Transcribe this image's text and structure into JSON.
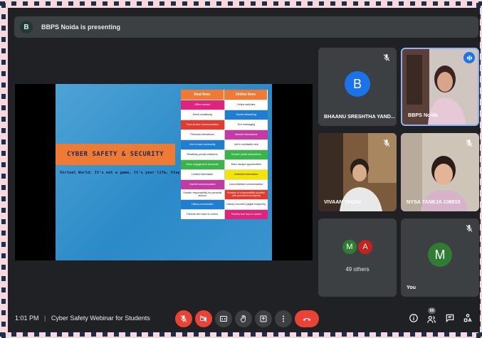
{
  "banner": {
    "avatar_letter": "B",
    "text": "BBPS Noida is presenting"
  },
  "slide": {
    "title": "CYBER SAFETY & SECURITY",
    "subtitle": "Virtual World: It's not a game, It's your life, Stay Safe !",
    "table": {
      "headers": [
        "Real lives",
        "Online lives"
      ],
      "rows": [
        {
          "left": "Office contact",
          "right": "Online activities",
          "lc": "#e0247d",
          "rc": "#ffffff"
        },
        {
          "left": "Direct socialising",
          "right": "Social networking",
          "lc": "#ffffff",
          "rc": "#1e7fd1"
        },
        {
          "left": "Face-to-face communication",
          "right": "Text messaging",
          "lc": "#e23a2e",
          "rc": "#ffffff"
        },
        {
          "left": "Personal interactions",
          "right": "Internet interactions",
          "lc": "#ffffff",
          "rc": "#c33aa4"
        },
        {
          "left": "Life in local community",
          "right": "Life in worldwide web",
          "lc": "#1e7fd1",
          "rc": "#ffffff"
        },
        {
          "left": "Relatively private existence",
          "right": "Greater public interactions",
          "lc": "#ffffff",
          "rc": "#39b54a"
        },
        {
          "left": "More engagement demands",
          "right": "More escape opportunities",
          "lc": "#39b54a",
          "rc": "#ffffff"
        },
        {
          "left": "Limited information",
          "right": "Unlimited information",
          "lc": "#ffffff",
          "rc": "#f2e500"
        },
        {
          "left": "Careful communication",
          "right": "Less inhibited communication",
          "lc": "#c33aa4",
          "rc": "#ffffff"
        },
        {
          "left": "Greater responsibility for personal actions",
          "right": "Evasion of responsibility possible with perceived anonymity",
          "lc": "#ffffff",
          "rc": "#e23a2e"
        },
        {
          "left": "History unrecorded",
          "right": "History recorded (digital footprints)",
          "lc": "#1e7fd1",
          "rc": "#ffffff"
        },
        {
          "left": "Parents feel more in control",
          "right": "Parents feel less in control",
          "lc": "#ffffff",
          "rc": "#e0247d"
        }
      ]
    }
  },
  "participants": {
    "bhaanu": {
      "letter": "B",
      "name": "BHAANU SRESHTHA YAND...",
      "color": "#1a73e8"
    },
    "bbps": {
      "name": "BBPS Noida"
    },
    "vivaan": {
      "name": "VIVAAN YADAV"
    },
    "nysa": {
      "name": "NYSA TANEJA 108815"
    },
    "others": {
      "letters": [
        "M",
        "A"
      ],
      "colors": [
        "#2e7d32",
        "#c5221f"
      ],
      "label": "49 others"
    },
    "you": {
      "letter": "M",
      "name": "You",
      "color": "#2e7d32"
    }
  },
  "bottom_bar": {
    "time": "1:01 PM",
    "separator": "|",
    "meeting_title": "Cyber Safety Webinar for Students",
    "people_count": "55"
  }
}
